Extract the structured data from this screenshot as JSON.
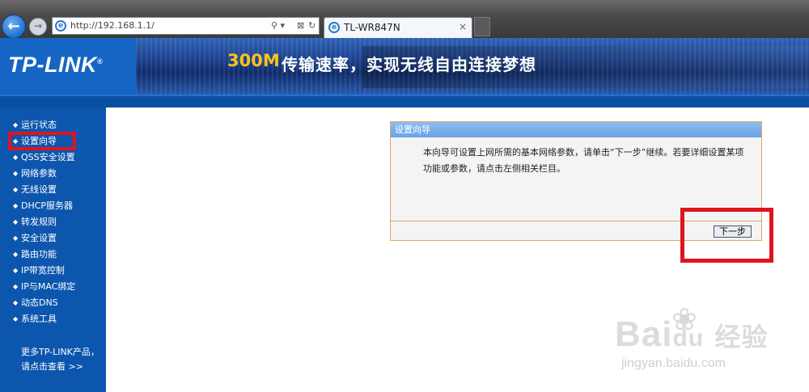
{
  "browser": {
    "url": "http://192.168.1.1/",
    "tab_title": "TL-WR847N",
    "tab_close": "×",
    "back_glyph": "←",
    "forward_glyph": "→",
    "address_icons": [
      "⚲ ▾",
      "⊠",
      "↻"
    ]
  },
  "header": {
    "logo": "TP-LINK",
    "logo_mark": "®",
    "slogan_accent": "300M",
    "slogan_main": "传输速率，实现无线自由连接梦想"
  },
  "sidebar": {
    "items": [
      {
        "label": "运行状态"
      },
      {
        "label": "设置向导"
      },
      {
        "label": "QSS安全设置"
      },
      {
        "label": "网络参数"
      },
      {
        "label": "无线设置"
      },
      {
        "label": "DHCP服务器"
      },
      {
        "label": "转发规则"
      },
      {
        "label": "安全设置"
      },
      {
        "label": "路由功能"
      },
      {
        "label": "IP带宽控制"
      },
      {
        "label": "IP与MAC绑定"
      },
      {
        "label": "动态DNS"
      },
      {
        "label": "系统工具"
      }
    ],
    "more_line1": "更多TP-LINK产品，",
    "more_line2": "请点击查看 >>"
  },
  "wizard": {
    "title": "设置向导",
    "description": "本向导可设置上网所需的基本网络参数，请单击“下一步”继续。若要详细设置某项功能或参数，请点击左侧相关栏目。",
    "next_label": "下一步"
  },
  "watermark": {
    "brand": "Bai",
    "brand2": "经验",
    "sub": "jingyan.baidu.com"
  },
  "colors": {
    "sidebar": "#0c56ae",
    "highlight": "#e0141e",
    "accent": "#ffc21a"
  }
}
